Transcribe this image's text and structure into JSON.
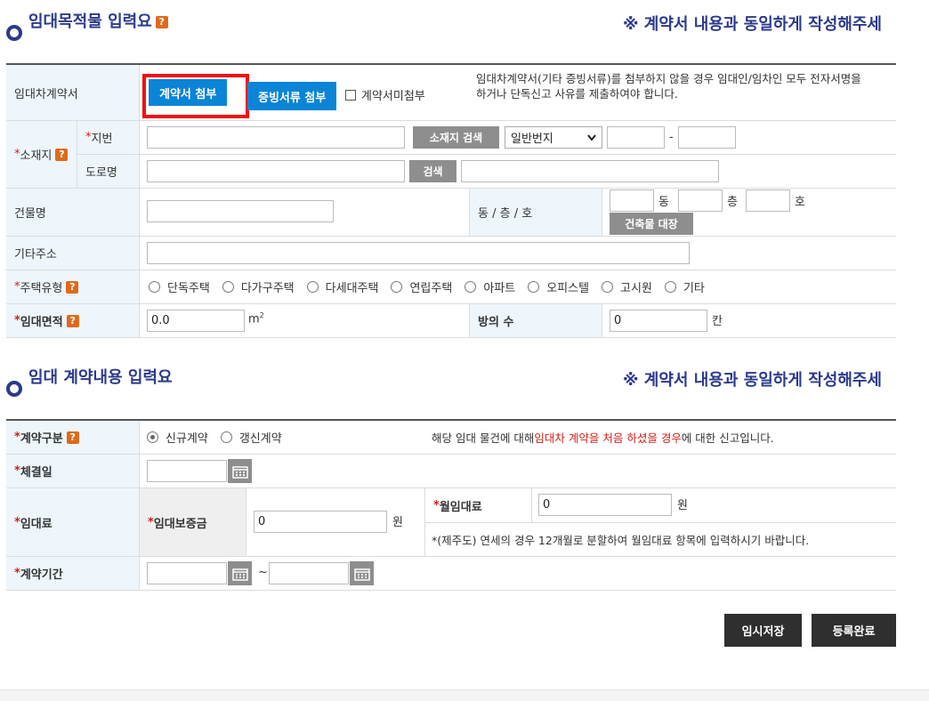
{
  "section1": {
    "title": "임대목적물 입력요",
    "notice": "※ 계약서 내용과 동일하게 작성해주세",
    "contract_doc": {
      "label": "임대차계약서",
      "attach_btn": "계약서 첨부",
      "evidence_btn": "증빙서류 첨부",
      "no_attach_label": "계약서미첨부",
      "info_line1": "임대차계약서(기타 증빙서류)를 첨부하지 않을 경우 임대인/임차인 모두 전자서명을",
      "info_line2": "하거나 단독신고 사유를 제출하여야 합니다."
    },
    "location": {
      "label": "소재지",
      "lot_label": "지번",
      "search_btn": "소재지 검색",
      "lot_type": "일반번지",
      "road_label": "도로명",
      "road_search_btn": "검색"
    },
    "building": {
      "label": "건물명",
      "dong_floor_label": "동 / 층 / 호",
      "dong_unit": "동",
      "floor_unit": "층",
      "ho_unit": "호",
      "registry_btn": "건축물 대장"
    },
    "other_address": {
      "label": "기타주소"
    },
    "housing_type": {
      "label": "주택유형",
      "options": [
        "단독주택",
        "다가구주택",
        "다세대주택",
        "연립주택",
        "아파트",
        "오피스텔",
        "고시원",
        "기타"
      ]
    },
    "area": {
      "label": "임대면적",
      "value": "0.0",
      "unit": "m",
      "unit_sup": "2",
      "rooms_label": "방의 수",
      "rooms_value": "0",
      "rooms_unit": "칸"
    }
  },
  "section2": {
    "title": "임대 계약내용 입력요",
    "notice": "※ 계약서 내용과 동일하게 작성해주세",
    "contract_type": {
      "label": "계약구분",
      "options": [
        "신규계약",
        "갱신계약"
      ],
      "selected": "신규계약",
      "desc_pre": "해당 임대 물건에 대해 ",
      "desc_red": "임대차 계약을 처음 하셨을 경우",
      "desc_post": "에 대한 신고입니다."
    },
    "signing_date": {
      "label": "체결일"
    },
    "rent": {
      "label": "임대료",
      "deposit_label": "임대보증금",
      "deposit_value": "0",
      "deposit_unit": "원",
      "monthly_label": "월임대료",
      "monthly_value": "0",
      "monthly_unit": "원",
      "jeju_note": "*(제주도) 연세의 경우 12개월로 분할하여 월임대료 항목에 입력하시기 바랍니다."
    },
    "period": {
      "label": "계약기간",
      "separator": "~"
    }
  },
  "actions": {
    "temp_save": "임시저장",
    "complete": "등록완료"
  },
  "colors": {
    "heading": "#2b3a8c",
    "label_bg": "#eef6fb",
    "primary_btn": "#0a84d6",
    "highlight": "#e11111",
    "required": "#d0201a",
    "dark_btn": "#2f2f2f"
  }
}
